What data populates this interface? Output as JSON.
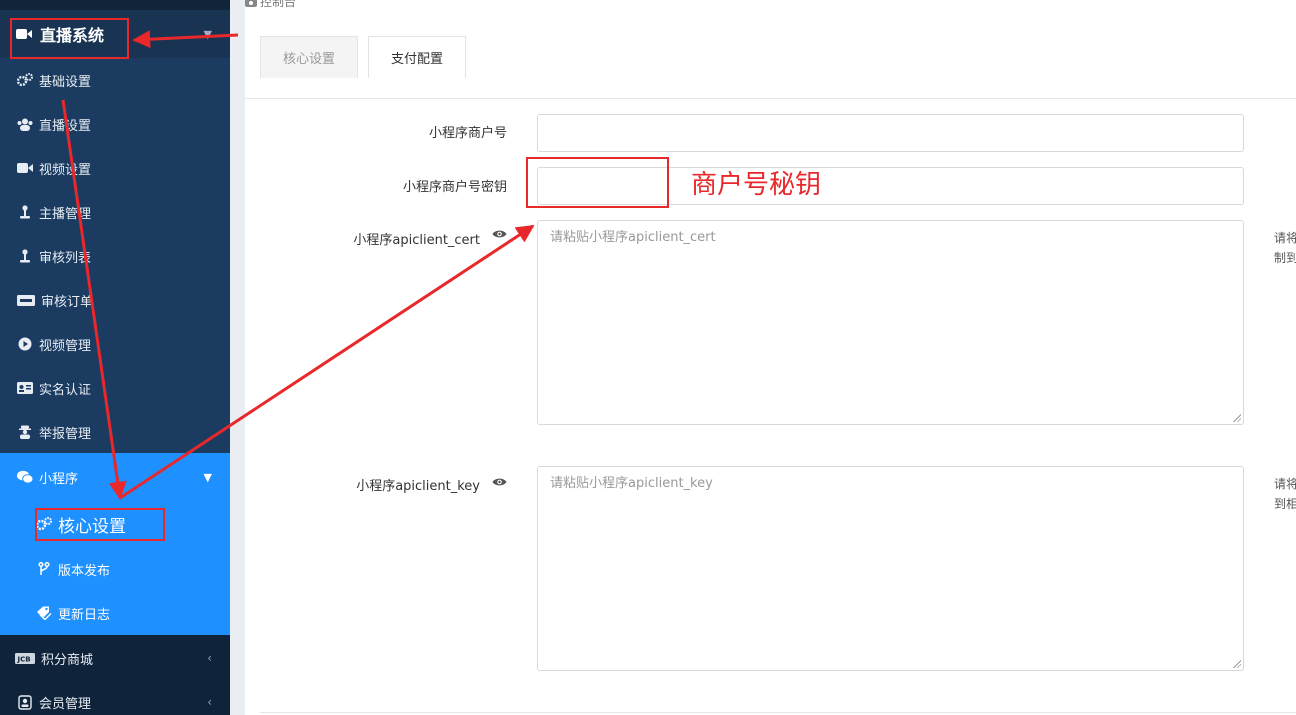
{
  "sidebar": {
    "section": {
      "label": "直播系统",
      "icon": "video-camera-icon"
    },
    "items": [
      {
        "label": "基础设置",
        "icon": "cogs-icon"
      },
      {
        "label": "直播设置",
        "icon": "users-icon"
      },
      {
        "label": "视频设置",
        "icon": "video-camera-icon"
      },
      {
        "label": "主播管理",
        "icon": "anchor-icon"
      },
      {
        "label": "审核列表",
        "icon": "anchor-icon"
      },
      {
        "label": "审核订单",
        "icon": "paypal-card-icon"
      },
      {
        "label": "视频管理",
        "icon": "play-circle-icon"
      },
      {
        "label": "实名认证",
        "icon": "id-card-icon"
      },
      {
        "label": "举报管理",
        "icon": "user-secret-icon"
      }
    ],
    "mini_program": {
      "label": "小程序",
      "icon": "wechat-icon",
      "children": [
        {
          "label": "核心设置",
          "icon": "cogs-icon"
        },
        {
          "label": "版本发布",
          "icon": "code-fork-icon"
        },
        {
          "label": "更新日志",
          "icon": "tags-icon"
        }
      ]
    },
    "bottom_items": [
      {
        "label": "积分商城",
        "icon": "jcb-card-icon"
      },
      {
        "label": "会员管理",
        "icon": "user-icon"
      }
    ]
  },
  "main": {
    "breadcrumb": "控制台",
    "tabs": [
      {
        "label": "核心设置",
        "active": false
      },
      {
        "label": "支付配置",
        "active": true
      }
    ],
    "form": {
      "merchant_id": {
        "label": "小程序商户号",
        "value": ""
      },
      "merchant_key": {
        "label": "小程序商户号密钥",
        "value": ""
      },
      "apiclient_cert": {
        "label": "小程序apiclient_cert",
        "placeholder": "请粘贴小程序apiclient_cert",
        "help_lines": [
          "请将",
          "制到"
        ]
      },
      "apiclient_key": {
        "label": "小程序apiclient_key",
        "placeholder": "请粘贴小程序apiclient_key",
        "help_lines": [
          "请将",
          "到相"
        ]
      }
    }
  },
  "annotation": {
    "text": "商户号秘钥",
    "color": "#e8282b"
  },
  "colors": {
    "sidebar_bg": "#1b3c60",
    "active_group_bg": "#1e90ff",
    "annotation": "#e8282b"
  }
}
